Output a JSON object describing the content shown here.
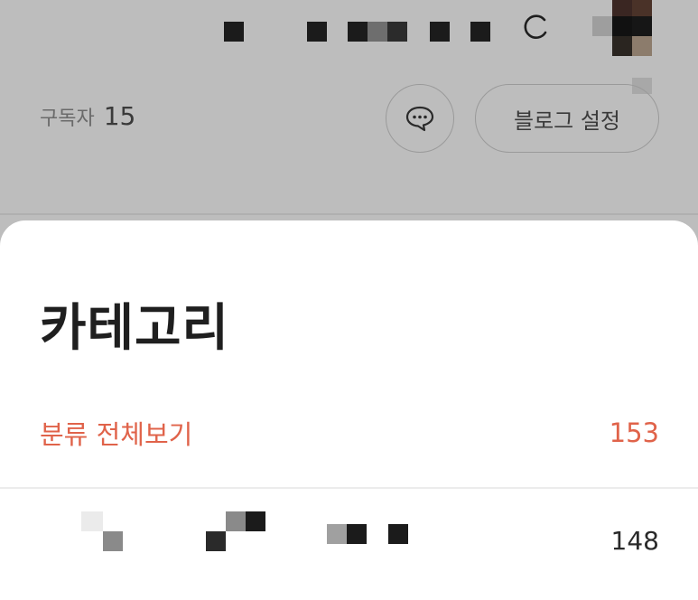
{
  "blog_header": {
    "subscriber_label": "구독자",
    "subscriber_count": "15",
    "settings_button_label": "블로그 설정",
    "chat_icon": "chat-bubble-icon",
    "refresh_icon": "refresh-icon"
  },
  "category_sheet": {
    "title": "카테고리",
    "all_categories": {
      "label": "분류 전체보기",
      "count": "153"
    },
    "categories": [
      {
        "count": "148"
      }
    ]
  },
  "colors": {
    "accent": "#e0634a",
    "overlay_background": "#bdbdbd",
    "sheet_background": "#ffffff"
  }
}
